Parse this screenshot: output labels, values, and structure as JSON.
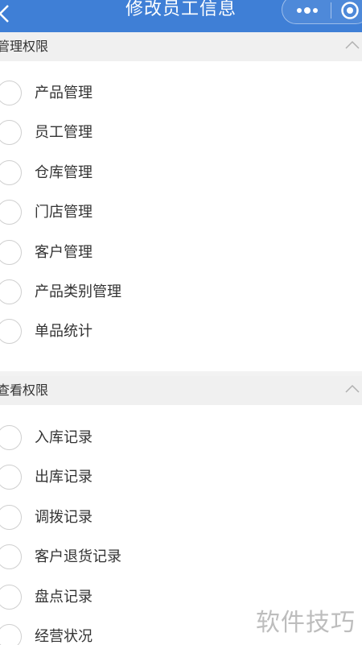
{
  "navbar": {
    "title": "修改员工信息",
    "back_icon": "chevron-left-icon",
    "more_icon": "more-dots-icon",
    "close_icon": "target-close-icon",
    "background": "#3f7fd6"
  },
  "manage_section": {
    "title": "管理权限",
    "options": [
      "产品管理",
      "员工管理",
      "仓库管理",
      "门店管理",
      "客户管理",
      "产品类别管理",
      "单品统计"
    ]
  },
  "view_section": {
    "title": "查看权限",
    "options": [
      "入库记录",
      "出库记录",
      "调拨记录",
      "客户退货记录",
      "盘点记录",
      "经营状况"
    ]
  },
  "watermark": "软件技巧"
}
